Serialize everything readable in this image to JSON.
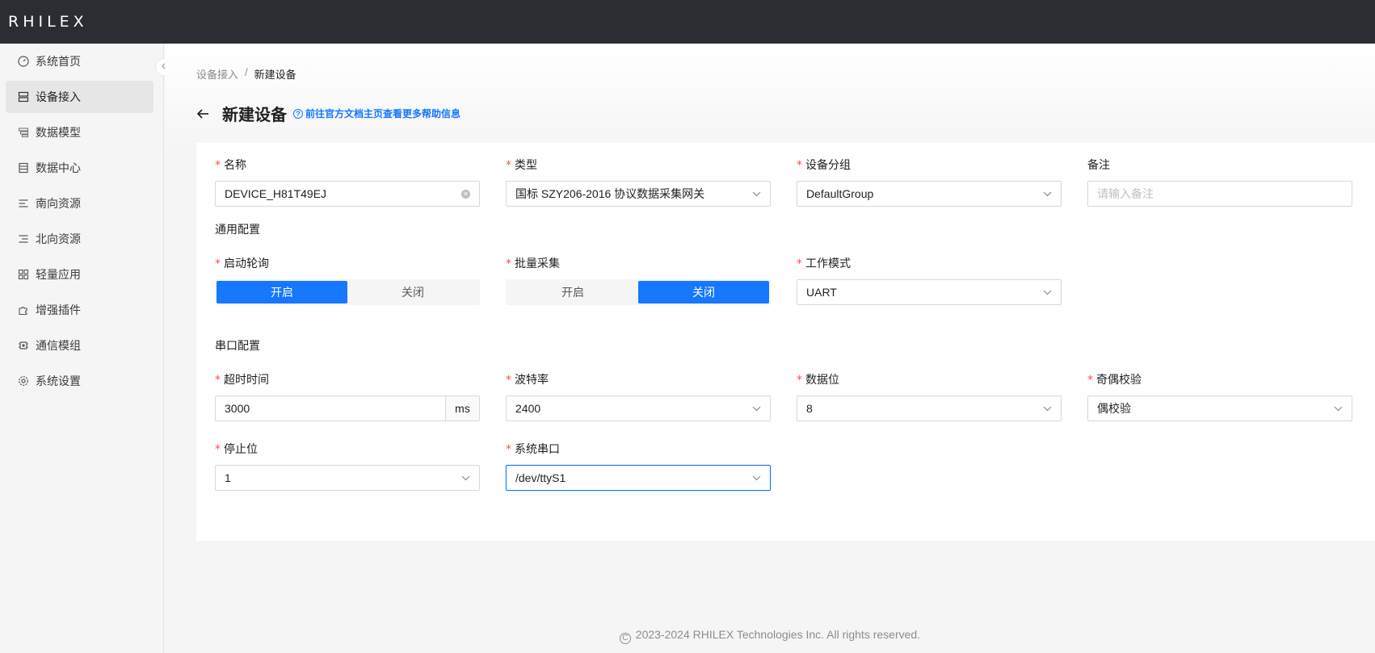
{
  "app": {
    "logo": "RHILEX"
  },
  "sidebar": {
    "items": [
      {
        "label": "系统首页",
        "icon": "dashboard-icon"
      },
      {
        "label": "设备接入",
        "icon": "device-icon",
        "active": true
      },
      {
        "label": "数据模型",
        "icon": "model-icon"
      },
      {
        "label": "数据中心",
        "icon": "database-icon"
      },
      {
        "label": "南向资源",
        "icon": "south-icon"
      },
      {
        "label": "北向资源",
        "icon": "north-icon"
      },
      {
        "label": "轻量应用",
        "icon": "apps-icon"
      },
      {
        "label": "增强插件",
        "icon": "plugin-icon"
      },
      {
        "label": "通信模组",
        "icon": "chip-icon"
      },
      {
        "label": "系统设置",
        "icon": "gear-icon"
      }
    ]
  },
  "breadcrumb": {
    "parent": "设备接入",
    "separator": "/",
    "current": "新建设备"
  },
  "header": {
    "title": "新建设备",
    "help_link": "前往官方文档主页查看更多帮助信息"
  },
  "form": {
    "name": {
      "label": "名称",
      "value": "DEVICE_H81T49EJ"
    },
    "type": {
      "label": "类型",
      "value": "国标 SZY206-2016 协议数据采集网关"
    },
    "group": {
      "label": "设备分组",
      "value": "DefaultGroup"
    },
    "remark": {
      "label": "备注",
      "placeholder": "请输入备注"
    },
    "general_section": "通用配置",
    "poll": {
      "label": "启动轮询",
      "on": "开启",
      "off": "关闭",
      "selected": "开启"
    },
    "batch": {
      "label": "批量采集",
      "on": "开启",
      "off": "关闭",
      "selected": "关闭"
    },
    "mode": {
      "label": "工作模式",
      "value": "UART"
    },
    "serial_section": "串口配置",
    "timeout": {
      "label": "超时时间",
      "value": "3000",
      "unit": "ms"
    },
    "baud": {
      "label": "波特率",
      "value": "2400"
    },
    "databits": {
      "label": "数据位",
      "value": "8"
    },
    "parity": {
      "label": "奇偶校验",
      "value": "偶校验"
    },
    "stopbits": {
      "label": "停止位",
      "value": "1"
    },
    "port": {
      "label": "系统串口",
      "value": "/dev/ttyS1"
    },
    "required_mark": "*"
  },
  "footer": {
    "copyright_symbol": "C",
    "text": "2023-2024 RHILEX Technologies Inc. All rights reserved."
  },
  "colors": {
    "primary": "#1677ff",
    "topbar": "#2a2d31",
    "required": "#ff4d4f"
  }
}
